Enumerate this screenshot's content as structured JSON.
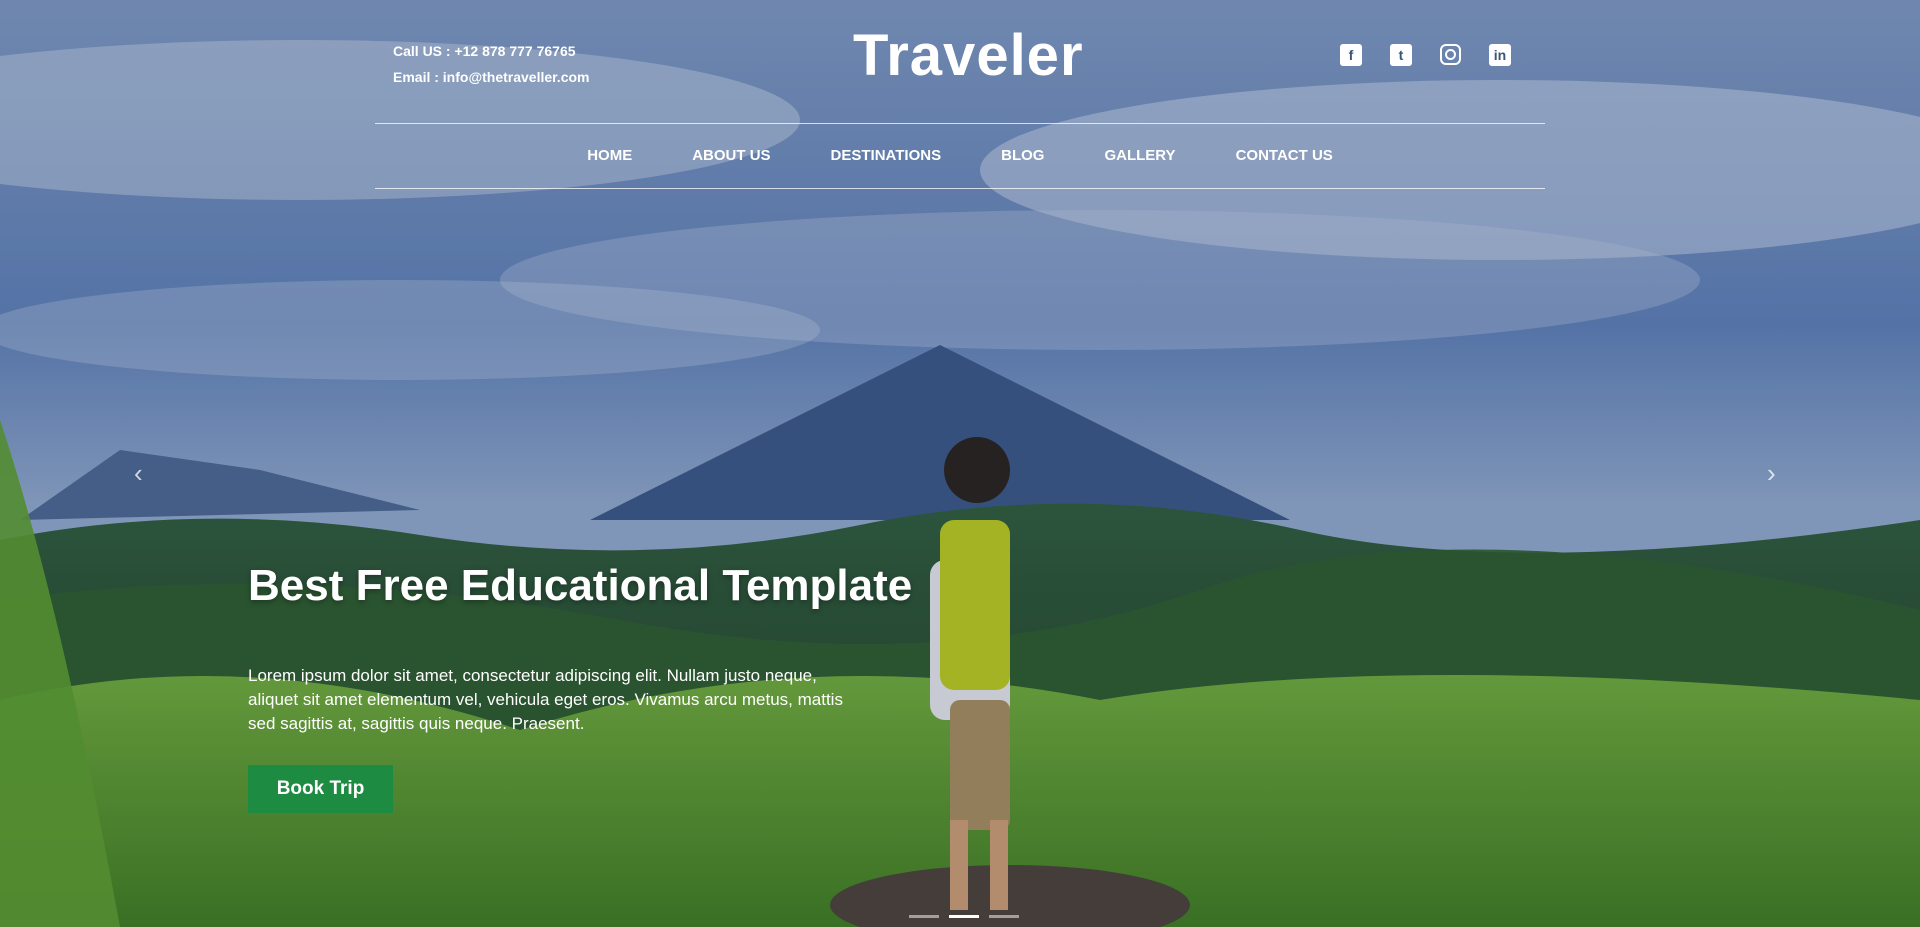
{
  "header": {
    "phone_label": "Call US : +12 878 777 76765",
    "email_label": "Email : info@thetraveller.com",
    "logo": "Traveler",
    "social": [
      {
        "name": "facebook-icon",
        "glyph": "f"
      },
      {
        "name": "twitter-icon",
        "glyph": "t"
      },
      {
        "name": "instagram-icon",
        "glyph": ""
      },
      {
        "name": "linkedin-icon",
        "glyph": "in"
      }
    ]
  },
  "nav": {
    "items": [
      "HOME",
      "ABOUT US",
      "DESTINATIONS",
      "BLOG",
      "GALLERY",
      "CONTACT US"
    ]
  },
  "hero": {
    "title": "Best Free Educational Template",
    "text": "Lorem ipsum dolor sit amet, consectetur adipiscing elit. Nullam justo neque, aliquet sit amet elementum vel, vehicula eget eros. Vivamus arcu metus, mattis sed sagittis at, sagittis quis neque. Praesent.",
    "button": "Book Trip",
    "prev_icon": "‹",
    "next_icon": "›",
    "slides_count": 3,
    "active_slide": 2
  },
  "colors": {
    "accent": "#1d8b41",
    "sky": "#5a7fb6",
    "grass": "#4f8f2c"
  }
}
